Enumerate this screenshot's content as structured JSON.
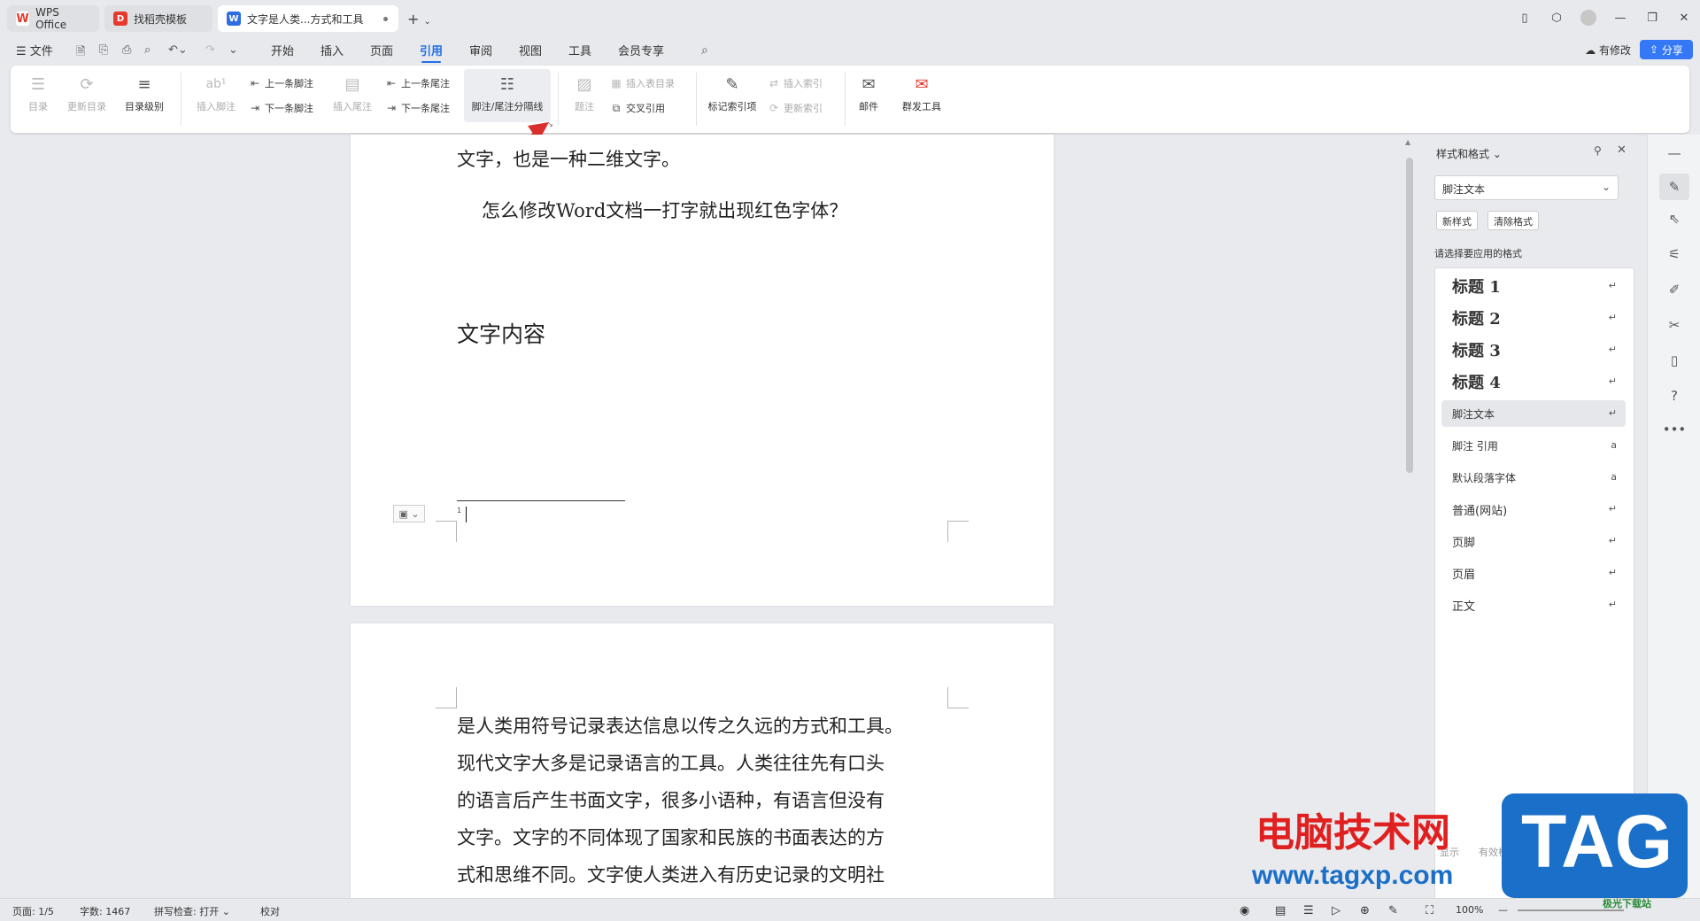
{
  "colors": {
    "accent": "#1f6fe5",
    "share": "#3478f6",
    "wps_red": "#e63a2e",
    "arrow": "#d9302b",
    "watermark_red": "#e02020",
    "watermark_blue": "#1a6fc9"
  },
  "tabs": [
    {
      "label": "WPS Office",
      "icon": "wps-logo-icon"
    },
    {
      "label": "找稻壳模板",
      "icon": "docer-icon"
    },
    {
      "label": "文字是人类...方式和工具",
      "icon": "word-doc-icon"
    }
  ],
  "menu": {
    "file": "文件",
    "items": [
      "开始",
      "插入",
      "页面",
      "引用",
      "审阅",
      "视图",
      "工具",
      "会员专享"
    ],
    "active": "引用",
    "sync_label": "有修改",
    "share_label": "分享"
  },
  "ribbon": {
    "toc": "目录",
    "update_toc": "更新目录",
    "toc_level": "目录级别",
    "insert_footnote": "插入脚注",
    "prev_footnote": "上一条脚注",
    "next_footnote": "下一条脚注",
    "insert_endnote": "插入尾注",
    "prev_endnote": "上一条尾注",
    "next_endnote": "下一条尾注",
    "separator": "脚注/尾注分隔线",
    "caption": "题注",
    "insert_table_of_figures": "插入表目录",
    "cross_ref": "交叉引用",
    "mark_index": "标记索引项",
    "insert_index": "插入索引",
    "update_index": "更新索引",
    "mail": "邮件",
    "mass_mail": "群发工具"
  },
  "document": {
    "page1_line1": "文字，也是一种二维文字。",
    "page1_line2": "怎么修改Word文档一打字就出现红色字体？",
    "page1_heading": "文字内容",
    "footnote_number": "1",
    "page2_lines": [
      "是人类用符号记录表达信息以传之久远的方式和工具。",
      "现代文字大多是记录语言的工具。人类往往先有口头",
      "的语言后产生书面文字，很多小语种，有语言但没有",
      "文字。文字的不同体现了国家和民族的书面表达的方",
      "式和思维不同。文字使人类进入有历史记录的文明社"
    ]
  },
  "panel": {
    "title": "样式和格式",
    "current_style": "脚注文本",
    "new_style": "新样式",
    "clear_format": "清除格式",
    "prompt": "请选择要应用的格式",
    "styles": [
      {
        "label": "标题  1",
        "kind": "heading"
      },
      {
        "label": "标题  2",
        "kind": "heading"
      },
      {
        "label": "标题  3",
        "kind": "heading"
      },
      {
        "label": "标题 4",
        "kind": "heading"
      },
      {
        "label": "脚注文本",
        "kind": "selected"
      },
      {
        "label": "脚注 引用",
        "kind": "char"
      },
      {
        "label": "默认段落字体",
        "kind": "char"
      },
      {
        "label": "普通(网站)",
        "kind": "normal"
      },
      {
        "label": "页脚",
        "kind": "normal"
      },
      {
        "label": "页眉",
        "kind": "normal"
      },
      {
        "label": "正文",
        "kind": "normal"
      }
    ],
    "show_label": "显示",
    "show_value": "有效样式"
  },
  "status": {
    "page": "页面: 1/5",
    "words": "字数: 1467",
    "spell": "拼写检查: 打开",
    "proof": "校对",
    "zoom": "100%"
  },
  "watermark": {
    "cn": "电脑技术网",
    "url": "www.tagxp.com",
    "tag": "TAG",
    "extra": "极光下载站"
  }
}
